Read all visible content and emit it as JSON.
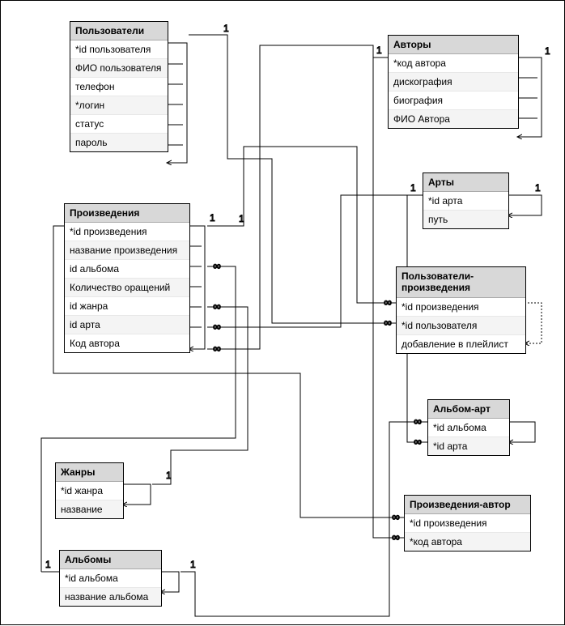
{
  "entities": {
    "users": {
      "title": "Пользователи",
      "fields": [
        "*id пользователя",
        "ФИО пользователя",
        "телефон",
        "*логин",
        "статус",
        "пароль"
      ]
    },
    "authors": {
      "title": "Авторы",
      "fields": [
        "*код автора",
        "дискография",
        "биография",
        "ФИО Автора"
      ]
    },
    "works": {
      "title": "Произведения",
      "fields": [
        "*id произведения",
        "название произведения",
        "id альбома",
        "Количество оращений",
        "id жанра",
        "id арта",
        "Код автора"
      ]
    },
    "arts": {
      "title": "Арты",
      "fields": [
        "*id арта",
        "путь"
      ]
    },
    "user_works": {
      "title": "Пользователи-произведения",
      "fields": [
        "*id произведения",
        "*id пользователя",
        "добавление в плейлист"
      ]
    },
    "album_art": {
      "title": "Альбом-арт",
      "fields": [
        "*id альбома",
        "*id арта"
      ]
    },
    "genres": {
      "title": "Жанры",
      "fields": [
        "*id жанра",
        "название"
      ]
    },
    "work_author": {
      "title": "Произведения-автор",
      "fields": [
        "*id произведения",
        "*код автора"
      ]
    },
    "albums": {
      "title": "Альбомы",
      "fields": [
        "*id альбома",
        "название альбома"
      ]
    }
  },
  "labels": {
    "one": "1",
    "many": "∞"
  },
  "chart_data": {
    "type": "er-diagram",
    "entities": [
      {
        "name": "Пользователи",
        "attributes": [
          "*id пользователя",
          "ФИО пользователя",
          "телефон",
          "*логин",
          "статус",
          "пароль"
        ]
      },
      {
        "name": "Авторы",
        "attributes": [
          "*код автора",
          "дискография",
          "биография",
          "ФИО Автора"
        ]
      },
      {
        "name": "Произведения",
        "attributes": [
          "*id произведения",
          "название произведения",
          "id альбома",
          "Количество оращений",
          "id жанра",
          "id арта",
          "Код автора"
        ]
      },
      {
        "name": "Арты",
        "attributes": [
          "*id арта",
          "путь"
        ]
      },
      {
        "name": "Пользователи-произведения",
        "attributes": [
          "*id произведения",
          "*id пользователя",
          "добавление в плейлист"
        ]
      },
      {
        "name": "Альбом-арт",
        "attributes": [
          "*id альбома",
          "*id арта"
        ]
      },
      {
        "name": "Жанры",
        "attributes": [
          "*id жанра",
          "название"
        ]
      },
      {
        "name": "Произведения-автор",
        "attributes": [
          "*id произведения",
          "*код автора"
        ]
      },
      {
        "name": "Альбомы",
        "attributes": [
          "*id альбома",
          "название альбома"
        ]
      }
    ],
    "relationships": [
      {
        "from": "Пользователи",
        "to": "Пользователи-произведения",
        "cardinality": "1:∞",
        "fk": "id пользователя"
      },
      {
        "from": "Произведения",
        "to": "Пользователи-произведения",
        "cardinality": "1:∞",
        "fk": "id произведения"
      },
      {
        "from": "Произведения",
        "to": "Произведения-автор",
        "cardinality": "1:∞",
        "fk": "id произведения"
      },
      {
        "from": "Авторы",
        "to": "Произведения-автор",
        "cardinality": "1:∞",
        "fk": "код автора"
      },
      {
        "from": "Авторы",
        "to": "Произведения",
        "cardinality": "1:∞",
        "fk": "Код автора"
      },
      {
        "from": "Жанры",
        "to": "Произведения",
        "cardinality": "1:∞",
        "fk": "id жанра"
      },
      {
        "from": "Арты",
        "to": "Произведения",
        "cardinality": "1:∞",
        "fk": "id арта"
      },
      {
        "from": "Арты",
        "to": "Альбом-арт",
        "cardinality": "1:∞",
        "fk": "id арта"
      },
      {
        "from": "Альбомы",
        "to": "Произведения",
        "cardinality": "1:∞",
        "fk": "id альбома"
      },
      {
        "from": "Альбомы",
        "to": "Альбом-арт",
        "cardinality": "1:∞",
        "fk": "id альбома"
      }
    ]
  }
}
